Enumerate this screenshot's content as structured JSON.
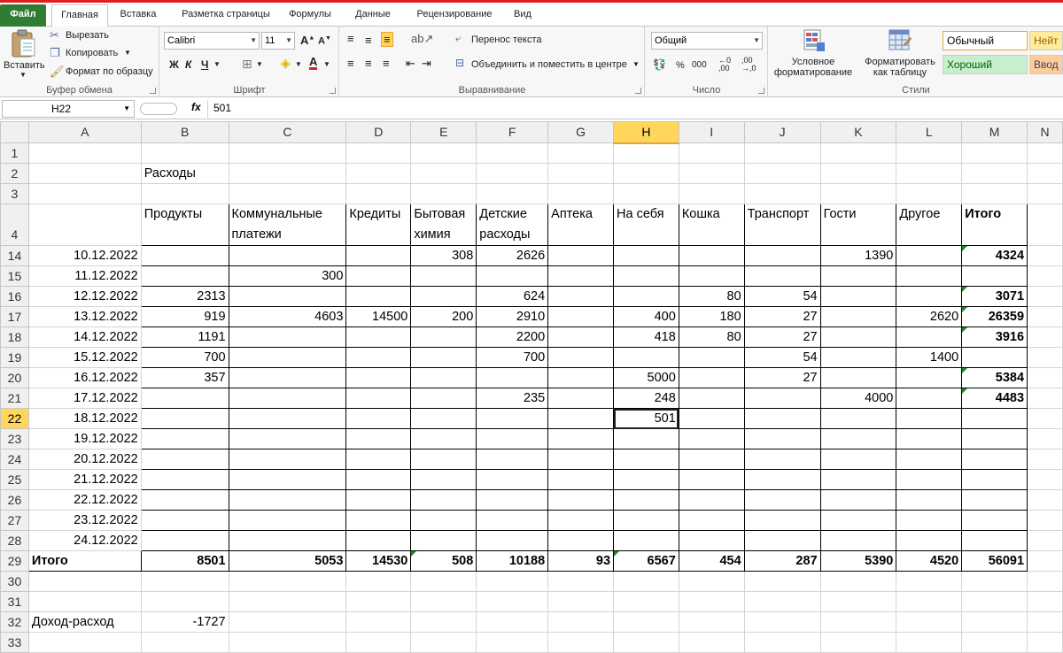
{
  "tabs": {
    "file": "Файл",
    "items": [
      "Главная",
      "Вставка",
      "Разметка страницы",
      "Формулы",
      "Данные",
      "Рецензирование",
      "Вид"
    ]
  },
  "ribbon": {
    "clipboard": {
      "paste": "Вставить",
      "cut": "Вырезать",
      "copy": "Копировать",
      "format_painter": "Формат по образцу",
      "label": "Буфер обмена"
    },
    "font": {
      "name": "Calibri",
      "size": "11",
      "bold": "Ж",
      "italic": "К",
      "underline": "Ч",
      "label": "Шрифт"
    },
    "alignment": {
      "wrap": "Перенос текста",
      "merge": "Объединить и поместить в центре",
      "label": "Выравнивание"
    },
    "number": {
      "format": "Общий",
      "label": "Число"
    },
    "styles": {
      "conditional": "Условное форматирование",
      "as_table": "Форматировать как таблицу",
      "normal": "Обычный",
      "neutral": "Нейт",
      "good": "Хороший",
      "input": "Ввод",
      "label": "Стили"
    }
  },
  "formula_bar": {
    "name_box": "H22",
    "fx": "fx",
    "value": "501"
  },
  "columns": [
    "A",
    "B",
    "C",
    "D",
    "E",
    "F",
    "G",
    "H",
    "I",
    "J",
    "K",
    "L",
    "M",
    "N"
  ],
  "sheet": {
    "title_row": {
      "row": "2",
      "text": "Расходы"
    },
    "header_row": {
      "row": "4",
      "cells": [
        "",
        "Продукты",
        "Коммунальные платежи",
        "Кредиты",
        "Бытовая химия",
        "Детские расходы",
        "Аптека",
        "На себя",
        "Кошка",
        "Транспорт",
        "Гости",
        "Другое",
        "Итого"
      ]
    },
    "data_rows": [
      {
        "row": "14",
        "cells": [
          "10.12.2022",
          "",
          "",
          "",
          "308",
          "2626",
          "",
          "",
          "",
          "",
          "1390",
          "",
          "4324"
        ]
      },
      {
        "row": "15",
        "cells": [
          "11.12.2022",
          "",
          "300",
          "",
          "",
          "",
          "",
          "",
          "",
          "",
          "",
          "",
          ""
        ]
      },
      {
        "row": "16",
        "cells": [
          "12.12.2022",
          "2313",
          "",
          "",
          "",
          "624",
          "",
          "",
          "80",
          "54",
          "",
          "",
          "3071"
        ]
      },
      {
        "row": "17",
        "cells": [
          "13.12.2022",
          "919",
          "4603",
          "14500",
          "200",
          "2910",
          "",
          "400",
          "180",
          "27",
          "",
          "2620",
          "26359"
        ]
      },
      {
        "row": "18",
        "cells": [
          "14.12.2022",
          "1191",
          "",
          "",
          "",
          "2200",
          "",
          "418",
          "80",
          "27",
          "",
          "",
          "3916"
        ]
      },
      {
        "row": "19",
        "cells": [
          "15.12.2022",
          "700",
          "",
          "",
          "",
          "700",
          "",
          "",
          "",
          "54",
          "",
          "1400",
          ""
        ]
      },
      {
        "row": "20",
        "cells": [
          "16.12.2022",
          "357",
          "",
          "",
          "",
          "",
          "",
          "5000",
          "",
          "27",
          "",
          "",
          "5384"
        ]
      },
      {
        "row": "21",
        "cells": [
          "17.12.2022",
          "",
          "",
          "",
          "",
          "235",
          "",
          "248",
          "",
          "",
          "4000",
          "",
          "4483"
        ]
      },
      {
        "row": "22",
        "cells": [
          "18.12.2022",
          "",
          "",
          "",
          "",
          "",
          "",
          "501",
          "",
          "",
          "",
          "",
          ""
        ]
      },
      {
        "row": "23",
        "cells": [
          "19.12.2022",
          "",
          "",
          "",
          "",
          "",
          "",
          "",
          "",
          "",
          "",
          "",
          ""
        ]
      },
      {
        "row": "24",
        "cells": [
          "20.12.2022",
          "",
          "",
          "",
          "",
          "",
          "",
          "",
          "",
          "",
          "",
          "",
          ""
        ]
      },
      {
        "row": "25",
        "cells": [
          "21.12.2022",
          "",
          "",
          "",
          "",
          "",
          "",
          "",
          "",
          "",
          "",
          "",
          ""
        ]
      },
      {
        "row": "26",
        "cells": [
          "22.12.2022",
          "",
          "",
          "",
          "",
          "",
          "",
          "",
          "",
          "",
          "",
          "",
          ""
        ]
      },
      {
        "row": "27",
        "cells": [
          "23.12.2022",
          "",
          "",
          "",
          "",
          "",
          "",
          "",
          "",
          "",
          "",
          "",
          ""
        ]
      },
      {
        "row": "28",
        "cells": [
          "24.12.2022",
          "",
          "",
          "",
          "",
          "",
          "",
          "",
          "",
          "",
          "",
          "",
          ""
        ]
      }
    ],
    "total_row": {
      "row": "29",
      "cells": [
        "Итого",
        "8501",
        "5053",
        "14530",
        "508",
        "10188",
        "93",
        "6567",
        "454",
        "287",
        "5390",
        "4520",
        "56091"
      ]
    },
    "income_row": {
      "row": "32",
      "label": "Доход-расход",
      "value": "-1727"
    },
    "empty_rows": [
      "1",
      "3",
      "30",
      "31",
      "33"
    ]
  },
  "colors": {
    "file_tab": "#2e7d32",
    "selection_header": "#ffd65c",
    "style_good": "#c6efce",
    "style_neutral": "#ffeb9c",
    "style_input": "#ffcc99",
    "indicator": "#1a8a2a"
  }
}
